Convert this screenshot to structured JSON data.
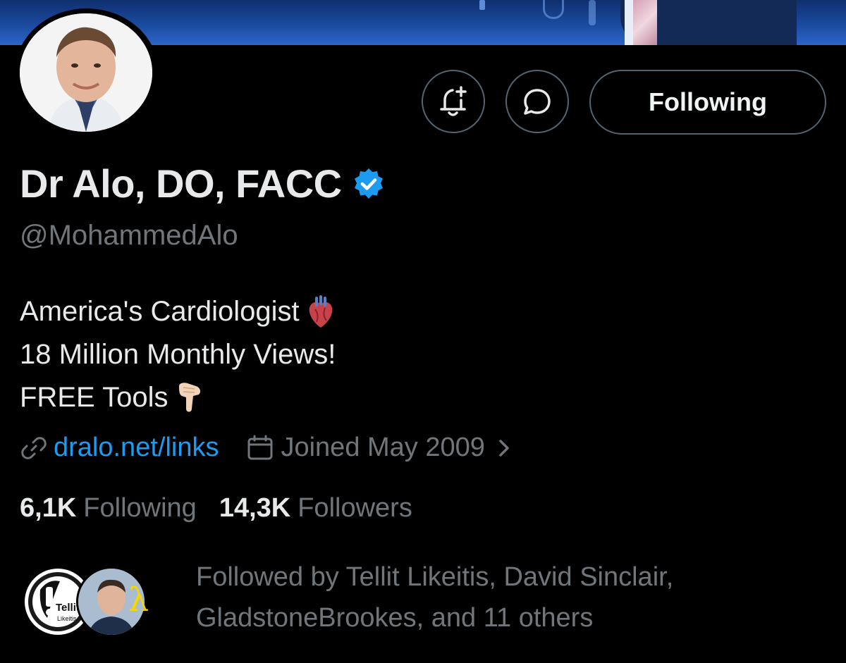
{
  "profile": {
    "display_name": "Dr Alo, DO, FACC",
    "handle": "@MohammedAlo",
    "verified": true,
    "bio_lines": [
      {
        "text": "America's Cardiologist",
        "emoji": "anatomical-heart"
      },
      {
        "text": "18 Million Monthly Views!",
        "emoji": ""
      },
      {
        "text": "FREE Tools",
        "emoji": "backhand-index-pointing-down"
      }
    ],
    "link_text": "dralo.net/links",
    "joined_text": "Joined May 2009"
  },
  "actions": {
    "follow_label": "Following",
    "notify_icon": "bell-plus-icon",
    "message_icon": "chat-bubble-icon"
  },
  "stats": {
    "following_count": "6,1K",
    "following_label": "Following",
    "followers_count": "14,3K",
    "followers_label": "Followers"
  },
  "followed_by": {
    "line1": "Followed by Tellit Likeitis, David Sinclair,",
    "line2": "GladstoneBrookes, and 11 others",
    "avatar1_text": "Tellit",
    "avatar1_subtext": "Likeitis",
    "avatar3_glyph": "λ"
  },
  "colors": {
    "background": "#000000",
    "primary_text": "#e7e9ea",
    "secondary_text": "#71767b",
    "link": "#1d9bf0",
    "verified_badge": "#1d9bf0",
    "button_border": "#536471"
  }
}
